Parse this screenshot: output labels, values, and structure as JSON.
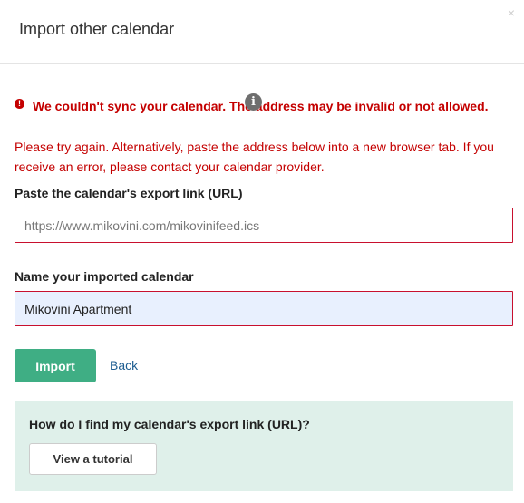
{
  "dialog": {
    "title": "Import other calendar",
    "close_glyph": "×"
  },
  "error": {
    "icon_glyph": "!",
    "heading": "We couldn't sync your calendar. The address may be invalid or not allowed.",
    "body": "Please try again. Alternatively, paste the address below into a new browser tab. If you receive an error, please contact your calendar provider.",
    "tooltip_glyph": "i",
    "color": "#c40000"
  },
  "form": {
    "url_label": "Paste the calendar's export link (URL)",
    "url_placeholder": "https://www.mikovini.com/mikovinifeed.ics",
    "url_value": "",
    "name_label": "Name your imported calendar",
    "name_value": "Mikovini Apartment"
  },
  "actions": {
    "import_label": "Import",
    "back_label": "Back"
  },
  "help": {
    "question": "How do I find my calendar's export link (URL)?",
    "tutorial_label": "View a tutorial"
  },
  "colors": {
    "primary_button": "#3fae84",
    "link": "#1d5d91",
    "help_panel_bg": "#dff0ea",
    "input_error_border": "#c8102e",
    "autofill_bg": "#e8f0fe"
  },
  "icons": [
    "close-icon",
    "error-icon",
    "info-icon"
  ]
}
